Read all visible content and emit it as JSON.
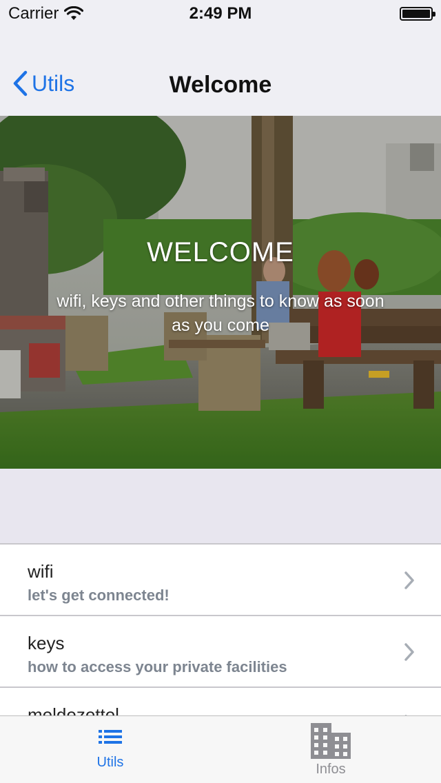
{
  "status_bar": {
    "carrier": "Carrier",
    "time": "2:49 PM"
  },
  "nav": {
    "back_label": "Utils",
    "title": "Welcome"
  },
  "hero": {
    "title": "WELCOME",
    "subtitle": "wifi, keys and other things to know as soon as you come"
  },
  "list": {
    "items": [
      {
        "title": "wifi",
        "subtitle": "let's get connected!"
      },
      {
        "title": "keys",
        "subtitle": "how to access your private facilities"
      },
      {
        "title": "meldezettel",
        "subtitle": ""
      }
    ]
  },
  "tab_bar": {
    "tabs": [
      {
        "label": "Utils",
        "icon": "list-icon",
        "active": true
      },
      {
        "label": "Infos",
        "icon": "building-icon",
        "active": false
      }
    ]
  },
  "colors": {
    "accent": "#1e73e6",
    "chrome": "#efeff4",
    "subtitle_gray": "#7d8590"
  }
}
